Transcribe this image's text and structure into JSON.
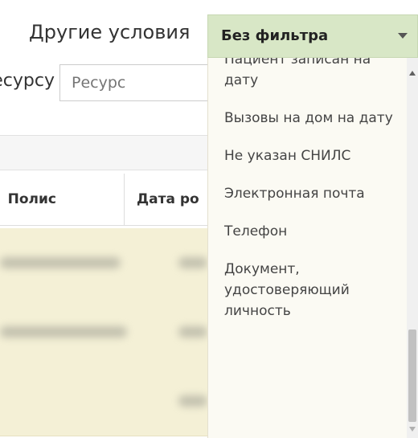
{
  "filters": {
    "other_conditions_label": "Другие условия",
    "resource_label": "Ресурсу",
    "resource_placeholder": "Ресурс"
  },
  "table": {
    "columns": [
      "Полис",
      "Дата ро"
    ]
  },
  "dropdown": {
    "selected": "Без фильтра",
    "options": [
      "Пациент записан на дату",
      "Вызовы на дом на дату",
      "Не указан СНИЛС",
      "Электронная почта",
      "Телефон",
      "Документ, удостоверяющий личность"
    ]
  },
  "colors": {
    "selected_bg": "#d8e7c6",
    "row_highlight": "#f4f0d6",
    "dropdown_bg": "#fbfaf3"
  }
}
